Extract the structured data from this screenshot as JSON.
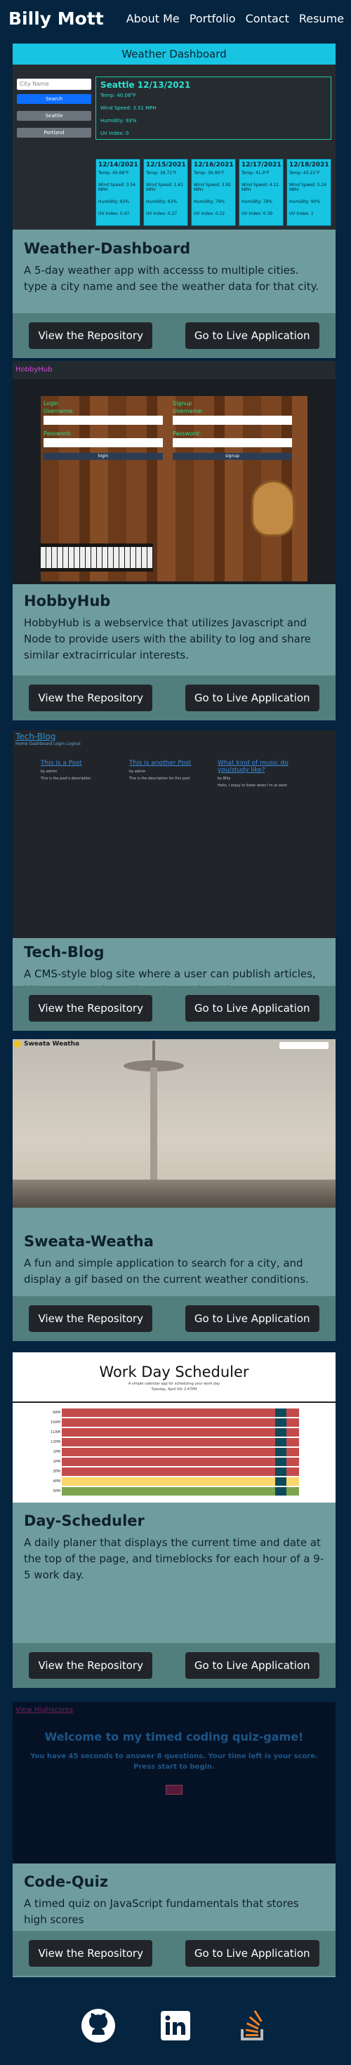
{
  "header": {
    "brand": "Billy Mott",
    "nav": [
      "About Me",
      "Portfolio",
      "Contact",
      "Resume"
    ]
  },
  "projects": [
    {
      "title": "Weather-Dashboard",
      "desc": "A 5-day weather app with accesss to multiple cities. type a city name and see the weather data for that city.",
      "repo": "View the Repository",
      "live": "Go to Live Application"
    },
    {
      "title": "HobbyHub",
      "desc": "HobbyHub is a webservice that utilizes Javascript and Node to provide users with the ability to log and share similar extracirricular interests.",
      "repo": "View the Repository",
      "live": "Go to Live Application"
    },
    {
      "title": "Tech-Blog",
      "desc": "A CMS-style blog site where a user can publish articles, blog posts, and any thoughts and opinions.",
      "repo": "View the Repository",
      "live": "Go to Live Application"
    },
    {
      "title": "Sweata-Weatha",
      "desc": "A fun and simple application to search for a city, and display a gif based on the current weather conditions.",
      "repo": "View the Repository",
      "live": "Go to Live Application"
    },
    {
      "title": "Day-Scheduler",
      "desc": "A daily planer that displays the current time and date at the top of the page, and timeblocks for each hour of a 9-5 work day.",
      "repo": "View the Repository",
      "live": "Go to Live Application"
    },
    {
      "title": "Code-Quiz",
      "desc": "A timed quiz on JavaScript fundamentals that stores high scores",
      "repo": "View the Repository",
      "live": "Go to Live Application"
    }
  ],
  "weather": {
    "bar": "Weather Dashboard",
    "input_placeholder": "City Name",
    "search": "Search",
    "cities": [
      "Seattle",
      "Portland"
    ],
    "current": {
      "title": "Seattle 12/13/2021",
      "lines": [
        "Temp: 40.06°F",
        "Wind Speed: 3.51 MPH",
        "Humidity: 93%",
        "UV Index: 0"
      ]
    },
    "forecast": [
      {
        "date": "12/14/2021",
        "lines": [
          "Temp: 40.68°F",
          "Wind Speed: 3.54 MPH",
          "Humidity: 93%",
          "UV Index: 0.47"
        ]
      },
      {
        "date": "12/15/2021",
        "lines": [
          "Temp: 38.71°F",
          "Wind Speed: 1.61 MPH",
          "Humidity: 83%",
          "UV Index: 0.27"
        ]
      },
      {
        "date": "12/16/2021",
        "lines": [
          "Temp: 36.99°F",
          "Wind Speed: 3.82 MPH",
          "Humidity: 79%",
          "UV Index: 0.22"
        ]
      },
      {
        "date": "12/17/2021",
        "lines": [
          "Temp: 41.9°F",
          "Wind Speed: 4.12 MPH",
          "Humidity: 79%",
          "UV Index: 0.39"
        ]
      },
      {
        "date": "12/18/2021",
        "lines": [
          "Temp: 43.21°F",
          "Wind Speed: 5.24 MPH",
          "Humidity: 90%",
          "UV Index: 1"
        ]
      }
    ]
  },
  "hobbyhub": {
    "brand": "HobbyHub",
    "login": "Login",
    "signup": "Signup",
    "login_fields": [
      "Username:",
      "Password:"
    ],
    "signup_fields": [
      "Username:",
      "Password:"
    ],
    "login_btn": "login",
    "signup_btn": "signup"
  },
  "techblog": {
    "title": "Tech-Blog",
    "sub": "Home Dashboard Login Logout",
    "posts": [
      {
        "title": "This is a Post",
        "by": "by admin",
        "body": "This is the post's description"
      },
      {
        "title": "This is another Post",
        "by": "by admin",
        "body": "This is the description for this post"
      },
      {
        "title": "What kind of music do you/study like?",
        "by": "by Billy",
        "body": "Hello, I enjoy to listen when I'm at work"
      }
    ]
  },
  "sweata": {
    "logo": "Sweata Weatha"
  },
  "scheduler": {
    "title": "Work Day Scheduler",
    "sub": "A simple calendar app for scheduling your work day",
    "date": "Tuesday, April 5th 2:47PM",
    "hours": [
      "9AM",
      "10AM",
      "11AM",
      "12PM",
      "1PM",
      "2PM",
      "3PM",
      "4PM",
      "5PM"
    ],
    "row_colors": [
      "#c44b4b",
      "#c44b4b",
      "#c44b4b",
      "#c44b4b",
      "#c44b4b",
      "#c44b4b",
      "#c44b4b",
      "#f8d76a",
      "#7ca44e"
    ]
  },
  "quiz": {
    "link": "View Highscores",
    "heading": "Welcome to my timed coding quiz-game!",
    "para": "You have 45 seconds to answer 8 questions. Your time left is your score. Press start to begin.",
    "start": "Start"
  },
  "footer": {
    "icons": [
      "github-icon",
      "linkedin-icon",
      "stackoverflow-icon"
    ]
  }
}
